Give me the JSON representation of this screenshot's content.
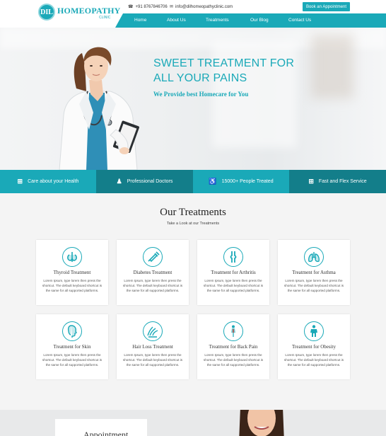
{
  "brand": {
    "badge": "DIL",
    "name": "HOMEOPATHY",
    "sub": "CLINIC"
  },
  "topbar": {
    "phone": "+91 8767846706",
    "email": "info@dilhomeopathyclinic.com",
    "book_label": "Book an Appointment"
  },
  "nav": {
    "items": [
      "Home",
      "About Us",
      "Treatments",
      "Our Blog",
      "Contact Us"
    ]
  },
  "hero": {
    "title": "SWEET TREATMENT FOR ALL YOUR PAINS",
    "subtitle": "We Provide best Homecare for You"
  },
  "features": [
    {
      "label": "Care about your Health",
      "icon": "plus-square-icon",
      "color": "#1aa9b8"
    },
    {
      "label": "Professional Doctors",
      "icon": "user-doctor-icon",
      "color": "#137e8a"
    },
    {
      "label": "15000+ People Treated",
      "icon": "wheelchair-icon",
      "color": "#1aa9b8"
    },
    {
      "label": "Fast and Flex Service",
      "icon": "plus-square-icon",
      "color": "#137e8a"
    }
  ],
  "treatments": {
    "title": "Our Treatments",
    "subtitle": "Take a Look at our Treatments",
    "desc": "Lorem Ipsum, type lorem then press the shortcut. The default keyboard shortcut is the same for all supported platforms.",
    "items": [
      {
        "title": "Thyroid Treatment",
        "icon": "thyroid-icon"
      },
      {
        "title": "Diabetes Treatment",
        "icon": "syringe-icon"
      },
      {
        "title": "Treatment for Arthritis",
        "icon": "knee-joint-icon"
      },
      {
        "title": "Treatment for Asthma",
        "icon": "lungs-icon"
      },
      {
        "title": "Treatment for Skin",
        "icon": "face-profile-icon"
      },
      {
        "title": "Hair Loss Treatment",
        "icon": "hair-icon"
      },
      {
        "title": "Treatment for Back Pain",
        "icon": "back-pain-icon"
      },
      {
        "title": "Treatment for Obesity",
        "icon": "obesity-icon"
      }
    ]
  },
  "bottom": {
    "heading": "Appointment"
  },
  "colors": {
    "accent": "#1aa9b8",
    "accent_dark": "#137e8a"
  }
}
